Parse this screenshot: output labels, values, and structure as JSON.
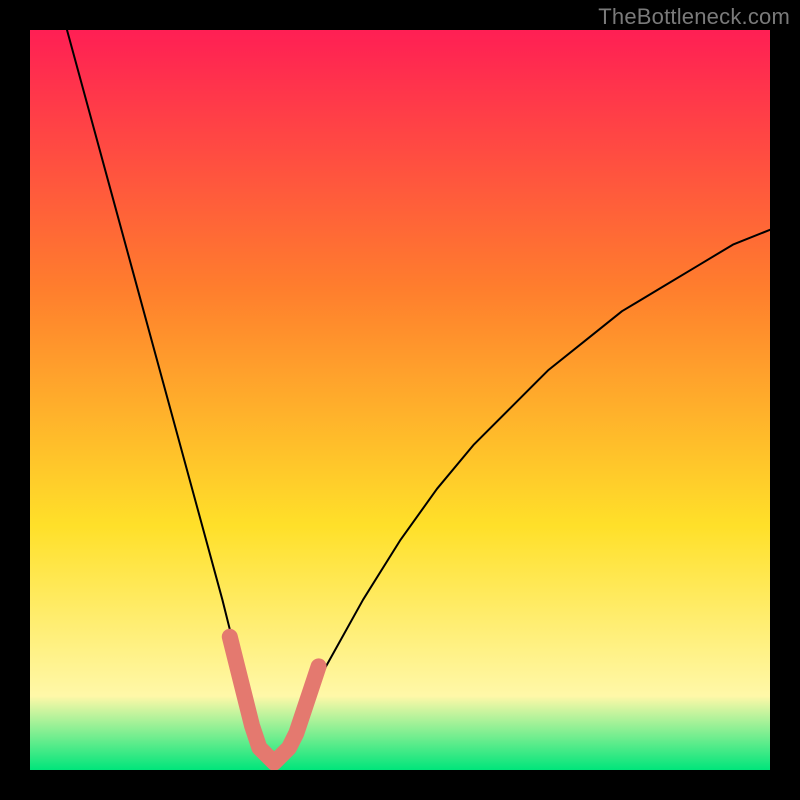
{
  "watermark": "TheBottleneck.com",
  "chart_data": {
    "type": "line",
    "title": "",
    "xlabel": "",
    "ylabel": "",
    "xlim": [
      0,
      100
    ],
    "ylim": [
      0,
      100
    ],
    "grid": false,
    "series": [
      {
        "name": "bottleneck-curve",
        "x": [
          5,
          8,
          11,
          14,
          17,
          20,
          23,
          26,
          28,
          30,
          31,
          32,
          33,
          34,
          35,
          37,
          40,
          45,
          50,
          55,
          60,
          65,
          70,
          75,
          80,
          85,
          90,
          95,
          100
        ],
        "y": [
          100,
          89,
          78,
          67,
          56,
          45,
          34,
          23,
          15,
          8,
          4,
          2,
          1,
          2,
          4,
          8,
          14,
          23,
          31,
          38,
          44,
          49,
          54,
          58,
          62,
          65,
          68,
          71,
          73
        ]
      },
      {
        "name": "highlight-segment",
        "x": [
          27,
          28,
          29,
          30,
          31,
          32,
          33,
          34,
          35,
          36,
          37,
          38,
          39
        ],
        "y": [
          18,
          14,
          10,
          6,
          3,
          2,
          1,
          2,
          3,
          5,
          8,
          11,
          14
        ]
      }
    ],
    "colors": {
      "gradient_top": "#ff1f54",
      "gradient_mid1": "#ff7e2d",
      "gradient_mid2": "#ffe029",
      "gradient_mid3": "#fff8a8",
      "gradient_bottom": "#00e57b",
      "curve": "#000000",
      "highlight": "#e4796f"
    }
  }
}
